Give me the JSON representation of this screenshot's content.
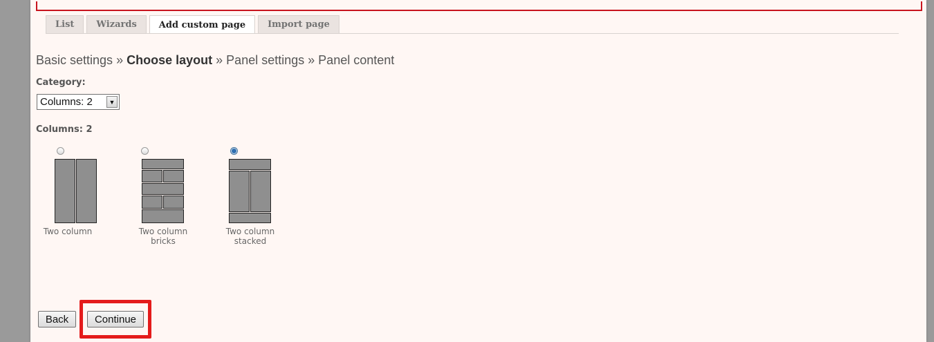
{
  "tabs": [
    {
      "label": "List",
      "active": false
    },
    {
      "label": "Wizards",
      "active": false
    },
    {
      "label": "Add custom page",
      "active": true
    },
    {
      "label": "Import page",
      "active": false
    }
  ],
  "breadcrumb": {
    "step1": "Basic settings",
    "sep": "»",
    "step2": "Choose layout",
    "step3": "Panel settings",
    "step4": "Panel content"
  },
  "category": {
    "label": "Category:",
    "selected": "Columns: 2"
  },
  "section_label": "Columns: 2",
  "layouts": [
    {
      "caption_line1": "Two column",
      "caption_line2": "",
      "selected": false
    },
    {
      "caption_line1": "Two column",
      "caption_line2": "bricks",
      "selected": false
    },
    {
      "caption_line1": "Two column",
      "caption_line2": "stacked",
      "selected": true
    }
  ],
  "buttons": {
    "back": "Back",
    "continue": "Continue"
  },
  "colors": {
    "highlight": "#e41b1b",
    "panel_background": "#fff7f4"
  }
}
